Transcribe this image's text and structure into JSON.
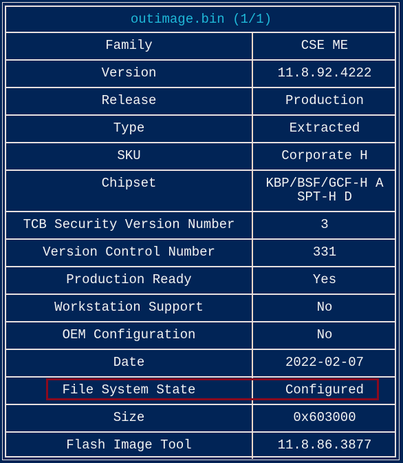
{
  "title": "outimage.bin (1/1)",
  "highlight_color": "#8b0a1e",
  "rows": [
    {
      "key": "Family",
      "value": "CSE ME"
    },
    {
      "key": "Version",
      "value": "11.8.92.4222"
    },
    {
      "key": "Release",
      "value": "Production"
    },
    {
      "key": "Type",
      "value": "Extracted"
    },
    {
      "key": "SKU",
      "value": "Corporate H"
    },
    {
      "key": "Chipset",
      "value": "KBP/BSF/GCF-H A\nSPT-H D"
    },
    {
      "key": "TCB Security Version Number",
      "value": "3"
    },
    {
      "key": "Version Control Number",
      "value": "331"
    },
    {
      "key": "Production Ready",
      "value": "Yes"
    },
    {
      "key": "Workstation Support",
      "value": "No"
    },
    {
      "key": "OEM Configuration",
      "value": "No"
    },
    {
      "key": "Date",
      "value": "2022-02-07"
    },
    {
      "key": "File System State",
      "value": "Configured"
    },
    {
      "key": "Size",
      "value": "0x603000"
    },
    {
      "key": "Flash Image Tool",
      "value": "11.8.86.3877"
    }
  ]
}
